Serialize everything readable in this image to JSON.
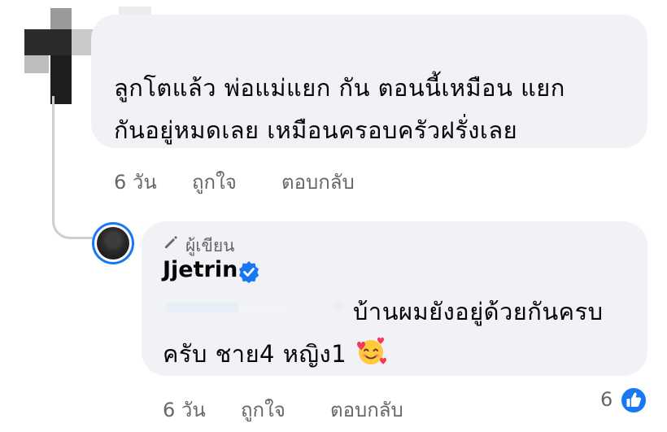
{
  "comment1": {
    "text_line1": "ลูกโตแล้ว  พ่อแม่แยก กัน   ตอนนี้เหมือน   แยก",
    "text_line2": "กันอยู่หมดเลย    เหมือนครอบครัวฝรั่งเลย",
    "time": "6 วัน",
    "like_label": "ถูกใจ",
    "reply_label": "ตอบกลับ"
  },
  "reply": {
    "badge_label": "ผู้เขียน",
    "author": "Jjetrin",
    "text_line1": "บ้านผมยังอยู่ด้วยกันครบ",
    "text_line2": "ครับ ชาย4 หญิง1",
    "emoji": "smiling-face-with-hearts",
    "time": "6 วัน",
    "like_label": "ถูกใจ",
    "reply_label": "ตอบกลับ",
    "reaction_count": "6",
    "reaction_icon": "like-icon"
  },
  "colors": {
    "bubble": "#f0f2f5",
    "meta": "#65676b",
    "accent": "#1877f2"
  }
}
